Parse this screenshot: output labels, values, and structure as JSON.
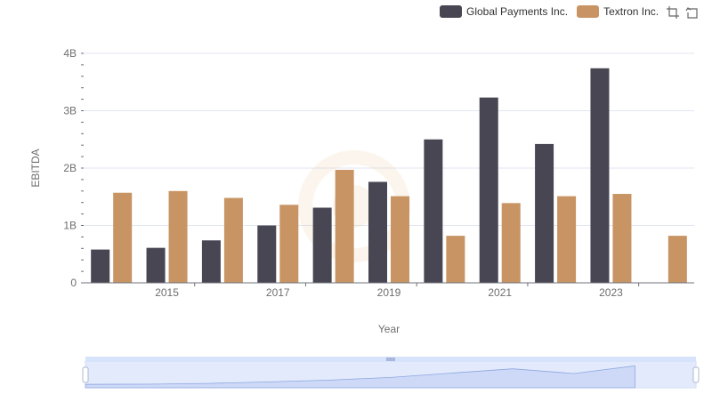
{
  "chart_data": {
    "type": "bar",
    "x": [
      2014,
      2015,
      2016,
      2017,
      2018,
      2019,
      2020,
      2021,
      2022,
      2023,
      2024
    ],
    "x_tick_labels": [
      "2015",
      "2017",
      "2019",
      "2021",
      "2023"
    ],
    "series": [
      {
        "name": "Global Payments Inc.",
        "color": "#474652",
        "values": [
          0.58,
          0.61,
          0.74,
          1.0,
          1.31,
          1.76,
          2.5,
          3.23,
          2.42,
          3.74,
          null
        ]
      },
      {
        "name": "Textron Inc.",
        "color": "#c89463",
        "values": [
          1.57,
          1.6,
          1.48,
          1.36,
          1.97,
          1.51,
          0.82,
          1.39,
          1.51,
          1.55,
          0.82
        ]
      }
    ],
    "xlabel": "Year",
    "ylabel": "EBITDA",
    "ylim": [
      0,
      4
    ],
    "y_unit": "B",
    "y_tick_labels": [
      "0",
      "1B",
      "2B",
      "3B",
      "4B"
    ],
    "grid": true,
    "legend_position": "top-right"
  },
  "toolbox": {
    "zoom_icon": "zoom-icon",
    "restore_icon": "restore-icon"
  }
}
